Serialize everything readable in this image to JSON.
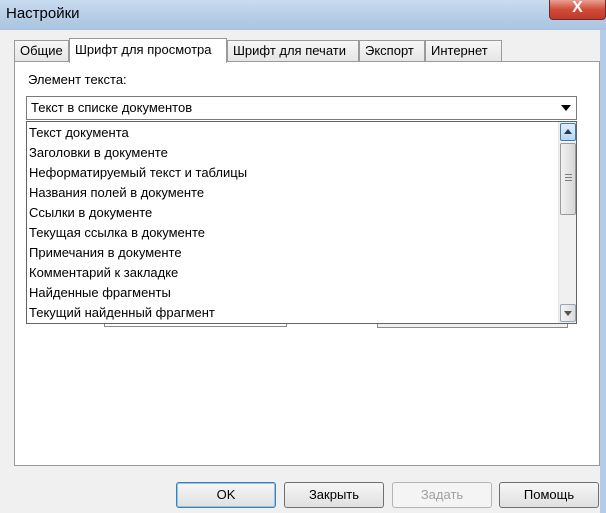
{
  "window": {
    "title": "Настройки",
    "close_label": "X"
  },
  "tabs": [
    {
      "label": "Общие",
      "active": false
    },
    {
      "label": "Шрифт для просмотра",
      "active": true
    },
    {
      "label": "Шрифт для печати",
      "active": false
    },
    {
      "label": "Экспорт",
      "active": false
    },
    {
      "label": "Интернет",
      "active": false
    }
  ],
  "element_label": "Элемент текста:",
  "combo": {
    "selected": "Текст в списке документов"
  },
  "dropdown_items": [
    "Текст документа",
    "Заголовки в документе",
    "Неформатируемый текст и таблицы",
    "Названия полей в документе",
    "Ссылки в документе",
    "Текущая ссылка в документе",
    "Примечания в документе",
    "Комментарий к закладке",
    "Найденные фрагменты",
    "Текущий найденный фрагмент"
  ],
  "buttons": {
    "ok": "OK",
    "close": "Закрыть",
    "apply": "Задать",
    "help": "Помощь"
  },
  "colors": {
    "title_bar": "#b4cce6",
    "close_button": "#c0392b",
    "panel_bg": "#ffffff",
    "dialog_bg": "#f0f0f0"
  }
}
